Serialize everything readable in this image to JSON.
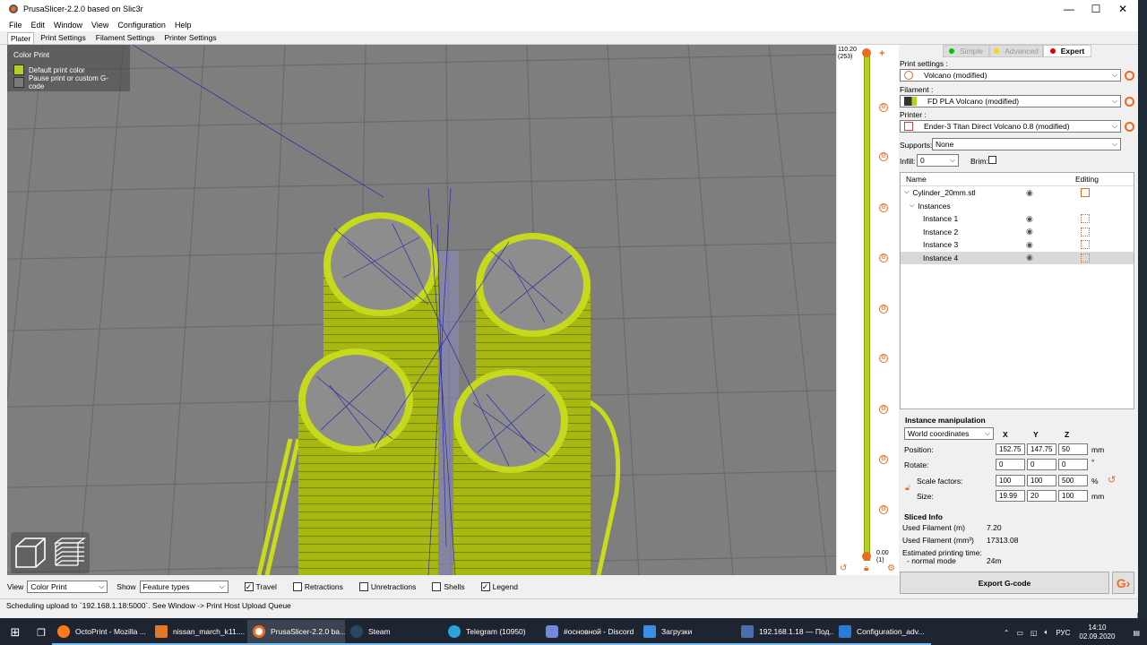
{
  "window": {
    "title": "PrusaSlicer-2.2.0 based on Slic3r",
    "controls": {
      "minimize": "—",
      "maximize": "☐",
      "close": "✕"
    }
  },
  "menu": [
    "File",
    "Edit",
    "Window",
    "View",
    "Configuration",
    "Help"
  ],
  "tabs": [
    "Plater",
    "Print Settings",
    "Filament Settings",
    "Printer Settings"
  ],
  "legend": {
    "title": "Color Print",
    "items": [
      {
        "label": "Default print color",
        "color": "#b5d126"
      },
      {
        "label": "Pause print or custom G-code",
        "color": "#7a7a7a"
      }
    ]
  },
  "layer_slider": {
    "top_value": "110.20",
    "top_layer": "(253)",
    "bottom_value": "0.00",
    "bottom_layer": "(1)"
  },
  "mode": {
    "simple": "Simple",
    "advanced": "Advanced",
    "expert": "Expert",
    "colors": {
      "simple": "#00c000",
      "advanced": "#ffd200",
      "expert": "#e00000"
    }
  },
  "presets": {
    "print_label": "Print settings :",
    "print_value": "Volcano (modified)",
    "filament_label": "Filament :",
    "filament_value": "FD PLA  Volcano (modified)",
    "printer_label": "Printer :",
    "printer_value": "Ender-3 Titan Direct Volcano 0.8 (modified)",
    "supports_label": "Supports:",
    "supports_value": "None",
    "infill_label": "Infill:",
    "infill_value": "0",
    "brim_label": "Brim:"
  },
  "object_list": {
    "col_name": "Name",
    "col_editing": "Editing",
    "object": "Cylinder_20mm.stl",
    "instances_label": "Instances",
    "instances": [
      "Instance 1",
      "Instance 2",
      "Instance 3",
      "Instance 4"
    ]
  },
  "instance_manipulation": {
    "title": "Instance manipulation",
    "coord_system": "World coordinates",
    "axes": [
      "X",
      "Y",
      "Z"
    ],
    "position_label": "Position:",
    "position": [
      "152.75",
      "147.75",
      "50"
    ],
    "position_unit": "mm",
    "rotate_label": "Rotate:",
    "rotate": [
      "0",
      "0",
      "0"
    ],
    "rotate_unit": "°",
    "scale_label": "Scale factors:",
    "scale": [
      "100",
      "100",
      "500"
    ],
    "scale_unit": "%",
    "size_label": "Size:",
    "size": [
      "19.99",
      "20",
      "100"
    ],
    "size_unit": "mm"
  },
  "sliced_info": {
    "title": "Sliced Info",
    "filament_m_label": "Used Filament (m)",
    "filament_m": "7.20",
    "filament_mm3_label": "Used Filament (mm³)",
    "filament_mm3": "17313.08",
    "time_label": "Estimated printing time:",
    "mode_label": "- normal mode",
    "time": "24m"
  },
  "export_button": "Export G-code",
  "bottom_bar": {
    "view_label": "View",
    "view_value": "Color Print",
    "show_label": "Show",
    "show_value": "Feature types",
    "checkboxes": [
      {
        "label": "Travel",
        "checked": true
      },
      {
        "label": "Retractions",
        "checked": false
      },
      {
        "label": "Unretractions",
        "checked": false
      },
      {
        "label": "Shells",
        "checked": false
      },
      {
        "label": "Legend",
        "checked": true
      }
    ]
  },
  "status": "Scheduling upload to `192.168.1.18:5000`. See Window -> Print Host Upload Queue",
  "taskbar": {
    "apps": [
      {
        "label": "OctoPrint - Mozilla ...",
        "icon_color": "#ff7a1a"
      },
      {
        "label": "nissan_march_k11....",
        "icon_color": "#e07a2a"
      },
      {
        "label": "PrusaSlicer-2.2.0 ba...",
        "icon_color": "#ed6b21"
      },
      {
        "label": "Steam",
        "icon_color": "#2a475e"
      },
      {
        "label": "Telegram (10950)",
        "icon_color": "#2aa3dc"
      },
      {
        "label": "#основной - Discord",
        "icon_color": "#7289da"
      },
      {
        "label": "Загрузки",
        "icon_color": "#3a8ee6"
      },
      {
        "label": "192.168.1.18 — Под...",
        "icon_color": "#4a6ea9"
      },
      {
        "label": "Configuration_adv...",
        "icon_color": "#2b7bd6"
      }
    ],
    "lang": "РУС",
    "time": "14:10",
    "date": "02.09.2020"
  }
}
